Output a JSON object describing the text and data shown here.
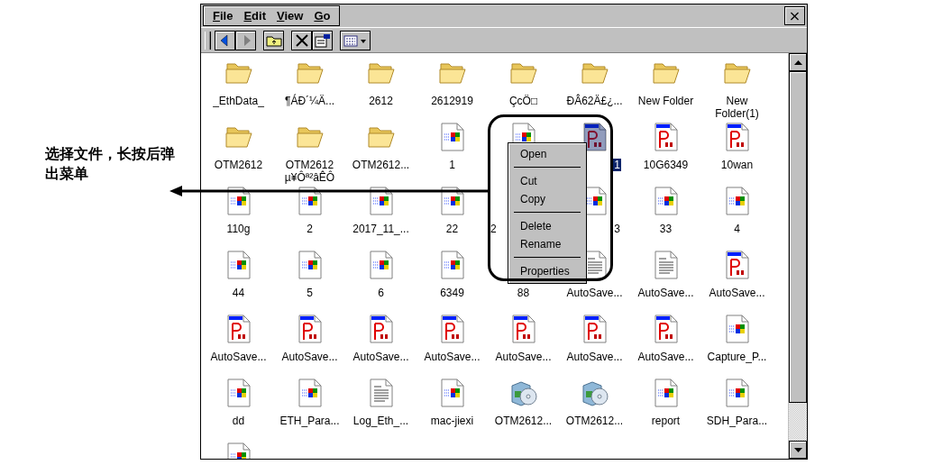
{
  "annotation": {
    "text": "选择文件，长按后弹出菜单"
  },
  "menu_bar": [
    "File",
    "Edit",
    "View",
    "Go"
  ],
  "close_button": "×",
  "toolbar": [
    {
      "kind": "back",
      "disabled": false
    },
    {
      "kind": "forward",
      "disabled": true
    },
    {
      "kind": "up"
    },
    {
      "kind": "delete"
    },
    {
      "kind": "properties"
    },
    {
      "kind": "view"
    }
  ],
  "files": [
    {
      "name": "_EthData_",
      "kind": "folder",
      "selected": false
    },
    {
      "name": "¶ÁÐ´¼Ä...",
      "kind": "folder",
      "selected": false
    },
    {
      "name": "2612",
      "kind": "folder",
      "selected": false
    },
    {
      "name": "2612919",
      "kind": "folder",
      "selected": false
    },
    {
      "name": "ÇcÖ□",
      "kind": "folder",
      "selected": false
    },
    {
      "name": "ÐÂ62Ä£¿...",
      "kind": "folder",
      "selected": false
    },
    {
      "name": "New Folder",
      "kind": "folder",
      "selected": false
    },
    {
      "name": "New\nFolder(1)",
      "kind": "folder",
      "selected": false
    },
    {
      "name": "OTM2612",
      "kind": "folder",
      "selected": false
    },
    {
      "name": "OTM2612\nµ¥Ôª²âÊÔ",
      "kind": "folder",
      "selected": false
    },
    {
      "name": "OTM2612...",
      "kind": "folder",
      "selected": false
    },
    {
      "name": "1",
      "kind": "app",
      "selected": false
    },
    {
      "kind": "app",
      "selected": false
    },
    {
      "name": "1",
      "kind": "pdf",
      "selected": true,
      "hidden_left": true
    },
    {
      "name": "10G6349",
      "kind": "pdf",
      "selected": false
    },
    {
      "name": "10wan",
      "kind": "pdf",
      "selected": false
    },
    {
      "name": "110g",
      "kind": "app",
      "selected": false
    },
    {
      "name": "2",
      "kind": "app",
      "selected": false
    },
    {
      "name": "2017_11_...",
      "kind": "app",
      "selected": false
    },
    {
      "name": "22",
      "kind": "app",
      "selected": false
    },
    {
      "name": "2",
      "kind": "app",
      "selected": false,
      "hidden_right": true
    },
    {
      "name": "3",
      "kind": "app",
      "selected": false,
      "hidden_left": true
    },
    {
      "name": "33",
      "kind": "app",
      "selected": false
    },
    {
      "name": "4",
      "kind": "app",
      "selected": false
    },
    {
      "name": "44",
      "kind": "app",
      "selected": false
    },
    {
      "name": "5",
      "kind": "app",
      "selected": false
    },
    {
      "name": "6",
      "kind": "app",
      "selected": false
    },
    {
      "name": "6349",
      "kind": "app",
      "selected": false
    },
    {
      "name": "88",
      "kind": "app",
      "selected": false
    },
    {
      "name": "AutoSave...",
      "kind": "text",
      "selected": false
    },
    {
      "name": "AutoSave...",
      "kind": "text",
      "selected": false
    },
    {
      "name": "AutoSave...",
      "kind": "pdf",
      "selected": false
    },
    {
      "name": "AutoSave...",
      "kind": "pdf",
      "selected": false
    },
    {
      "name": "AutoSave...",
      "kind": "pdf",
      "selected": false
    },
    {
      "name": "AutoSave...",
      "kind": "pdf",
      "selected": false
    },
    {
      "name": "AutoSave...",
      "kind": "pdf",
      "selected": false
    },
    {
      "name": "AutoSave...",
      "kind": "pdf",
      "selected": false
    },
    {
      "name": "AutoSave...",
      "kind": "pdf",
      "selected": false
    },
    {
      "name": "AutoSave...",
      "kind": "pdf",
      "selected": false
    },
    {
      "name": "Capture_P...",
      "kind": "app",
      "selected": false
    },
    {
      "name": "dd",
      "kind": "app",
      "selected": false
    },
    {
      "name": "ETH_Para...",
      "kind": "app",
      "selected": false
    },
    {
      "name": "Log_Eth_...",
      "kind": "text",
      "selected": false
    },
    {
      "name": "mac-jiexi",
      "kind": "app",
      "selected": false
    },
    {
      "name": "OTM2612...",
      "kind": "setup",
      "selected": false
    },
    {
      "name": "OTM2612...",
      "kind": "setup",
      "selected": false
    },
    {
      "name": "report",
      "kind": "app",
      "selected": false
    },
    {
      "name": "SDH_Para...",
      "kind": "app",
      "selected": false
    },
    {
      "kind": "app",
      "selected": false
    }
  ],
  "context_menu": [
    {
      "kind": "item",
      "label": "Open"
    },
    {
      "kind": "separator"
    },
    {
      "kind": "item",
      "label": "Cut"
    },
    {
      "kind": "item",
      "label": "Copy"
    },
    {
      "kind": "separator"
    },
    {
      "kind": "item",
      "label": "Delete"
    },
    {
      "kind": "item",
      "label": "Rename"
    },
    {
      "kind": "separator"
    },
    {
      "kind": "item",
      "label": "Properties"
    }
  ]
}
